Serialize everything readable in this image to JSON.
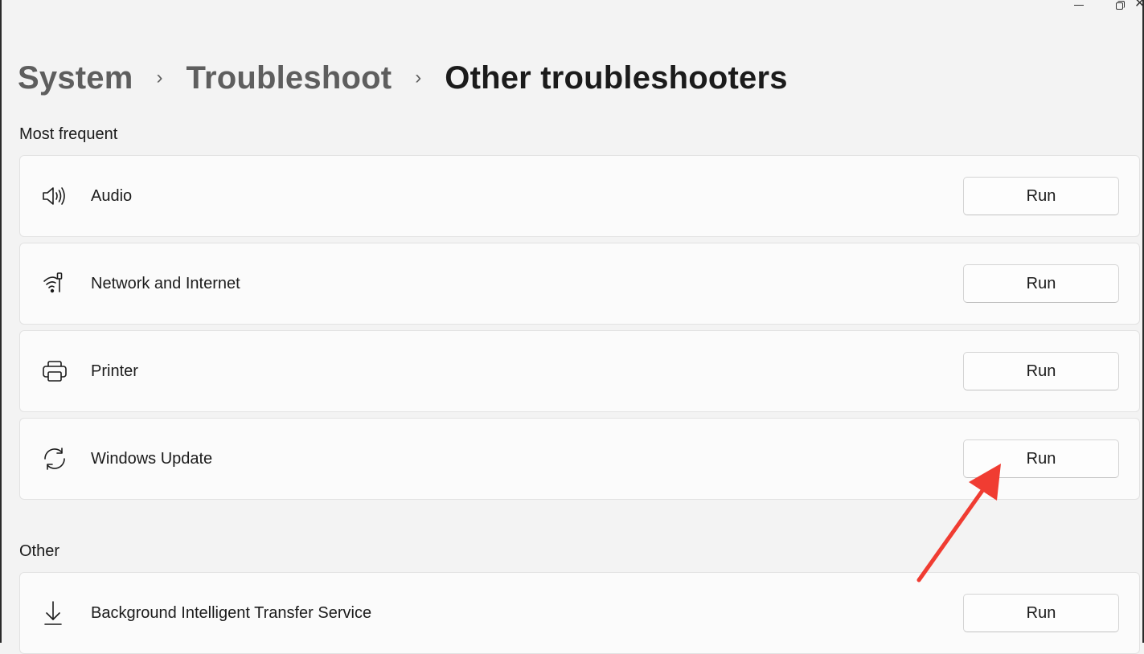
{
  "window": {
    "minimize_icon": "minimize-icon",
    "maximize_icon": "restore-icon",
    "close_glyph": "✕"
  },
  "breadcrumb": {
    "items": [
      "System",
      "Troubleshoot"
    ],
    "current": "Other troubleshooters",
    "separator": "›"
  },
  "sections": {
    "most_frequent": "Most frequent",
    "other": "Other"
  },
  "troubleshooters": [
    {
      "label": "Audio",
      "icon": "speaker-icon",
      "button": "Run"
    },
    {
      "label": "Network and Internet",
      "icon": "network-icon",
      "button": "Run"
    },
    {
      "label": "Printer",
      "icon": "printer-icon",
      "button": "Run"
    },
    {
      "label": "Windows Update",
      "icon": "sync-icon",
      "button": "Run"
    }
  ],
  "other_troubleshooters": [
    {
      "label": "Background Intelligent Transfer Service",
      "icon": "download-icon",
      "button": "Run"
    }
  ],
  "annotation": {
    "color": "#f03c32",
    "target": "Windows Update Run button"
  },
  "colors": {
    "background": "#f3f3f3",
    "card": "#fbfbfb",
    "text": "#1b1b1b",
    "muted": "#5e5e5e"
  }
}
